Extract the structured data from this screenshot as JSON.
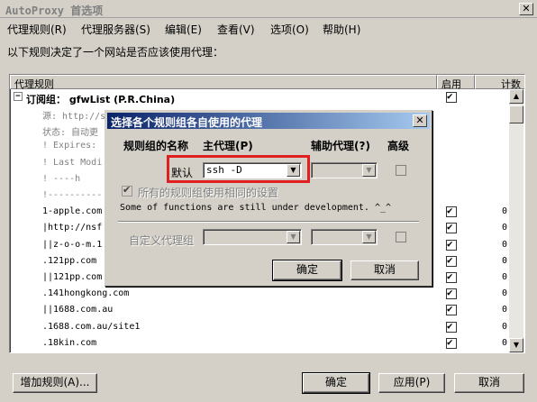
{
  "window": {
    "title": "AutoProxy 首选项",
    "close": "✕"
  },
  "menu": [
    {
      "label": "代理规则(R)"
    },
    {
      "label": "代理服务器(S)"
    },
    {
      "label": "编辑(E)"
    },
    {
      "label": "查看(V)"
    },
    {
      "label": "选项(O)"
    },
    {
      "label": "帮助(H)"
    }
  ],
  "caption": "以下规则决定了一个网站是否应该使用代理：",
  "list": {
    "headers": {
      "rule": "代理规则",
      "enabled": "启用",
      "count": "计数"
    },
    "group": {
      "title": "订阅组： gfwList (P.R.China)",
      "expander": "−"
    },
    "rows": [
      {
        "text": "源: http://s",
        "style": "gray",
        "checked": false,
        "count": ""
      },
      {
        "text": "状态: 自动更",
        "style": "gray",
        "checked": false,
        "count": ""
      },
      {
        "text": "! Expires:",
        "style": "gray",
        "checked": false,
        "count": ""
      },
      {
        "text": "! Last Modi",
        "style": "gray",
        "checked": false,
        "count": ""
      },
      {
        "text": "!     ----h",
        "style": "gray",
        "checked": false,
        "count": ""
      },
      {
        "text": "!----------",
        "style": "gray",
        "checked": false,
        "count": ""
      },
      {
        "text": "1-apple.com",
        "style": "",
        "checked": true,
        "count": "0"
      },
      {
        "text": "|http://nsf",
        "style": "",
        "checked": true,
        "count": "0"
      },
      {
        "text": "||z-o-o-m.1",
        "style": "",
        "checked": true,
        "count": "0"
      },
      {
        "text": ".121pp.com",
        "style": "",
        "checked": true,
        "count": "0"
      },
      {
        "text": "||121pp.com",
        "style": "",
        "checked": true,
        "count": "0"
      },
      {
        "text": ".141hongkong.com",
        "style": "",
        "checked": true,
        "count": "0"
      },
      {
        "text": "||1688.com.au",
        "style": "",
        "checked": true,
        "count": "0"
      },
      {
        "text": ".1688.com.au/site1",
        "style": "",
        "checked": true,
        "count": "0"
      },
      {
        "text": ".18kin.com",
        "style": "",
        "checked": true,
        "count": "0"
      }
    ]
  },
  "scroll": {
    "up": "▲",
    "down": "▼"
  },
  "buttons": {
    "add_rule": "增加规则(A)...",
    "ok": "确定",
    "apply": "应用(P)",
    "cancel": "取消"
  },
  "dialog": {
    "title": "选择各个规则组各自使用的代理",
    "close": "✕",
    "col_name": "规则组的名称",
    "col_main": "主代理(P)",
    "col_aux": "辅助代理(?)",
    "col_adv": "高级",
    "default_label": "默认",
    "main_proxy_value": "ssh -D",
    "arrow": "▼",
    "same_settings_label": "所有的规则组使用相同的设置",
    "dev_note": "Some of functions are still under development. ^_^",
    "custom_label": "自定义代理组",
    "ok": "确定",
    "cancel": "取消"
  },
  "colors": {
    "highlight": "#e02020",
    "dialog_title": "#0a246a"
  }
}
